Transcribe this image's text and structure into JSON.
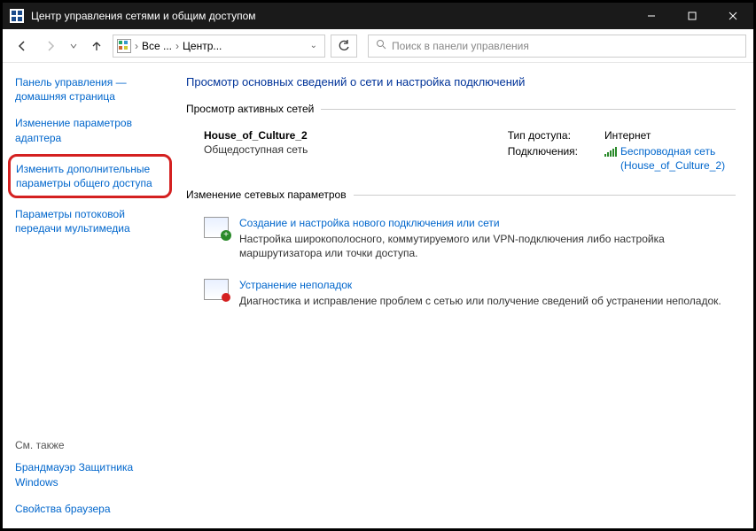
{
  "window": {
    "title": "Центр управления сетями и общим доступом"
  },
  "nav": {
    "crumb1": "Все ...",
    "crumb2": "Центр...",
    "search_placeholder": "Поиск в панели управления"
  },
  "sidebar": {
    "home": "Панель управления — домашняя страница",
    "adapter": "Изменение параметров адаптера",
    "advanced_sharing": "Изменить дополнительные параметры общего доступа",
    "media_streaming": "Параметры потоковой передачи мультимедиа",
    "see_also": "См. также",
    "firewall": "Брандмауэр Защитника Windows",
    "browser_props": "Свойства браузера"
  },
  "content": {
    "heading": "Просмотр основных сведений о сети и настройка подключений",
    "active_networks_label": "Просмотр активных сетей",
    "network": {
      "name": "House_of_Culture_2",
      "type": "Общедоступная сеть",
      "access_label": "Тип доступа:",
      "access_value": "Интернет",
      "connections_label": "Подключения:",
      "connection_link": "Беспроводная сеть (House_of_Culture_2)"
    },
    "change_settings_label": "Изменение сетевых параметров",
    "tasks": {
      "setup_title": "Создание и настройка нового подключения или сети",
      "setup_desc": "Настройка широкополосного, коммутируемого или VPN-подключения либо настройка маршрутизатора или точки доступа.",
      "trouble_title": "Устранение неполадок",
      "trouble_desc": "Диагностика и исправление проблем с сетью или получение сведений об устранении неполадок."
    }
  }
}
